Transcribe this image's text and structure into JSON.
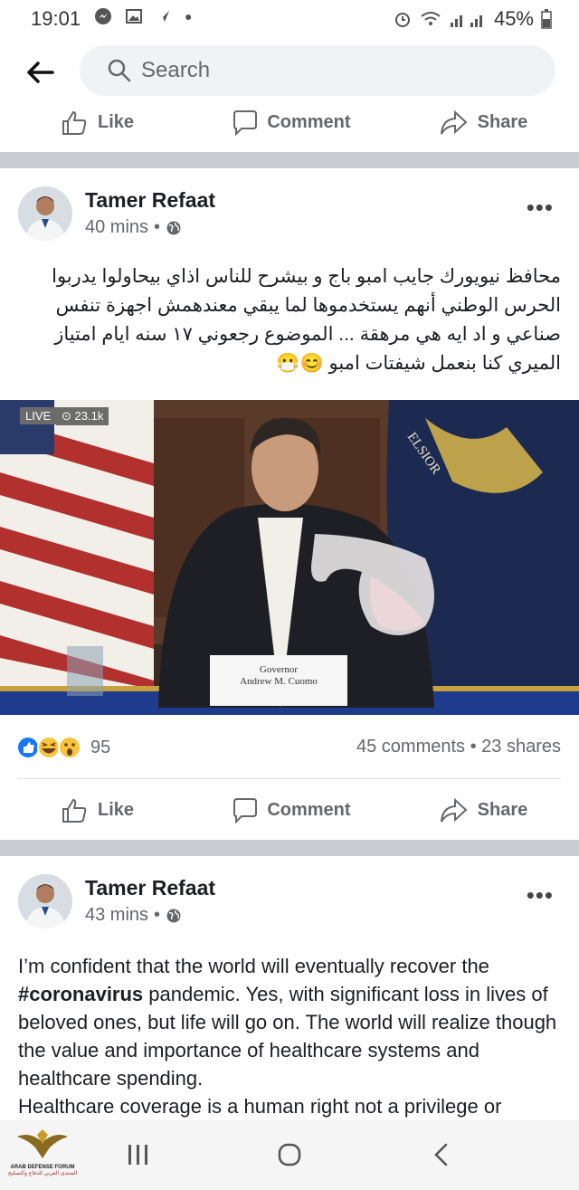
{
  "status_bar": {
    "time": "19:01",
    "battery": "45%"
  },
  "search": {
    "placeholder": "Search"
  },
  "actions": {
    "like": "Like",
    "comment": "Comment",
    "share": "Share"
  },
  "posts": [
    {
      "author": "Tamer Refaat",
      "time": "40 mins",
      "text_lines": [
        "محافظ نيويورك جايب امبو باج و بيشرح للناس اذاي بيحاولوا يدربوا",
        "الحرس الوطني أنهم يستخدموها لما يبقي معندهمش اجهزة تنفس",
        "صناعي و اد ايه هي مرهقة ... الموضوع رجعوني ١٧ سنه ايام امتياز",
        "الميري كنا بنعمل شيفتات امبو 😊😷"
      ],
      "video": {
        "live_label": "LIVE",
        "views": "23.1k",
        "flag_text": "ELSIOR",
        "podium_line1": "Governor",
        "podium_line2": "Andrew M. Cuomo"
      },
      "reaction_count": "95",
      "comments_shares": "45 comments • 23 shares"
    },
    {
      "author": "Tamer Refaat",
      "time": "43 mins",
      "text_before": "I’m confident that the world will eventually recover the",
      "hashtag": "#coronavirus",
      "text_after": " pandemic. Yes, with significant loss in lives of beloved ones, but life will go on. The world will realize though the value and importance of healthcare systems and healthcare spending.",
      "text_line2": "Healthcare coverage is a human right not a privilege or"
    }
  ],
  "watermark": {
    "line1": "ARAB DEFENSE FORUM",
    "line2": "المنتدى العربي للدفاع والتسليح"
  },
  "colors": {
    "accent": "#1877f2",
    "divider": "#c9ccd1",
    "secondary_text": "#65676b"
  }
}
